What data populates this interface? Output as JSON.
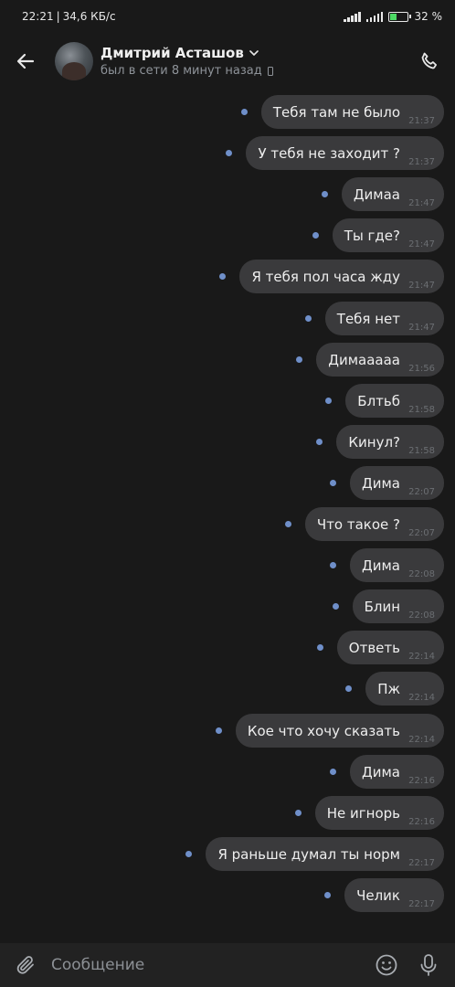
{
  "status_bar": {
    "time": "22:21",
    "speed": "34,6 КБ/с",
    "battery": "32",
    "battery_unit": "%",
    "battery_level": 0.32
  },
  "header": {
    "name": "Дмитрий Асташов",
    "status": "был в сети 8 минут назад"
  },
  "messages": [
    {
      "text": "Тебя там не было",
      "time": "21:37"
    },
    {
      "text": "У тебя не заходит ?",
      "time": "21:37"
    },
    {
      "text": "Димаа",
      "time": "21:47"
    },
    {
      "text": "Ты где?",
      "time": "21:47"
    },
    {
      "text": "Я тебя пол часа жду",
      "time": "21:47"
    },
    {
      "text": "Тебя нет",
      "time": "21:47"
    },
    {
      "text": "Димааааа",
      "time": "21:56"
    },
    {
      "text": "Блтьб",
      "time": "21:58"
    },
    {
      "text": "Кинул?",
      "time": "21:58"
    },
    {
      "text": "Дима",
      "time": "22:07"
    },
    {
      "text": "Что такое ?",
      "time": "22:07"
    },
    {
      "text": "Дима",
      "time": "22:08"
    },
    {
      "text": "Блин",
      "time": "22:08"
    },
    {
      "text": "Ответь",
      "time": "22:14"
    },
    {
      "text": "Пж",
      "time": "22:14"
    },
    {
      "text": "Кое что хочу сказать",
      "time": "22:14"
    },
    {
      "text": "Дима",
      "time": "22:16"
    },
    {
      "text": "Не игнорь",
      "time": "22:16"
    },
    {
      "text": "Я раньше думал ты норм",
      "time": "22:17"
    },
    {
      "text": "Челик",
      "time": "22:17"
    }
  ],
  "composer": {
    "placeholder": "Сообщение"
  },
  "colors": {
    "background": "#191919",
    "bubble": "#3a3a3c",
    "unread_dot": "#6f8fc9"
  },
  "icons": {
    "back": "arrow-left-icon",
    "call": "phone-icon",
    "attach": "paperclip-icon",
    "emoji": "smile-icon",
    "mic": "microphone-icon"
  }
}
